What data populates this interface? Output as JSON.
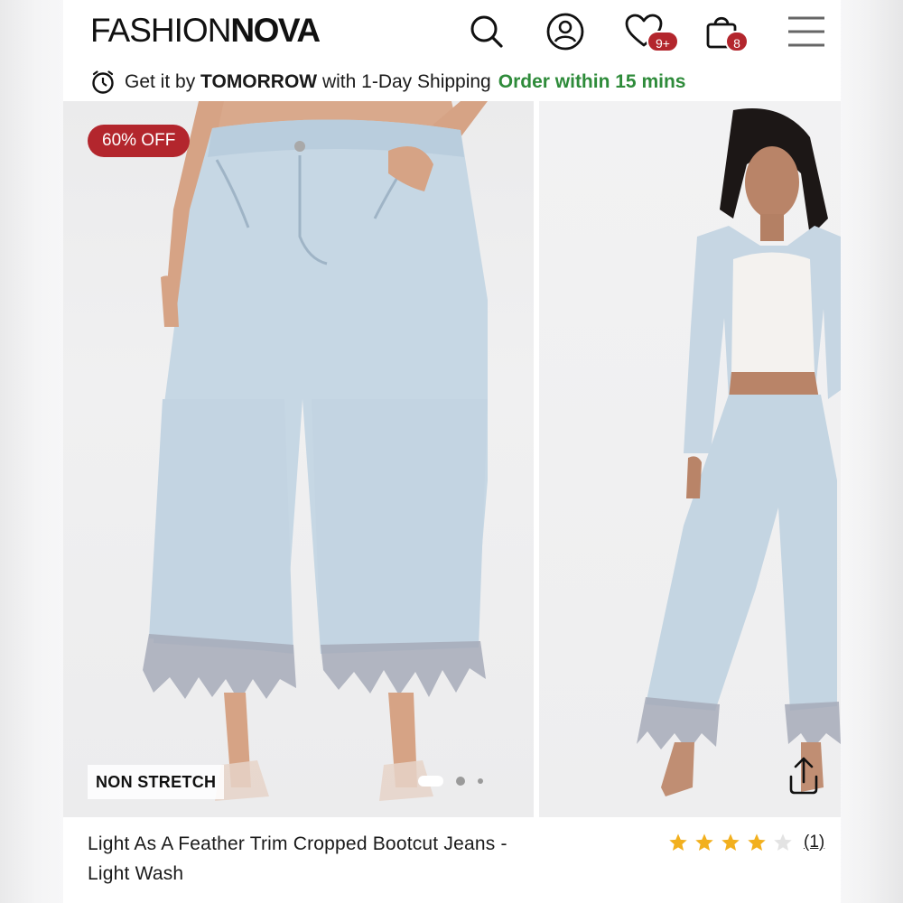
{
  "header": {
    "logo_part1": "FASHION",
    "logo_part2": "NOVA",
    "wishlist_badge": "9+",
    "cart_badge": "8",
    "icons": [
      "search-icon",
      "account-icon",
      "wishlist-heart-icon",
      "cart-bag-icon",
      "menu-hamburger-icon"
    ]
  },
  "shipping": {
    "prefix": "Get it by ",
    "highlight": "TOMORROW",
    "suffix": " with 1-Day Shipping",
    "countdown": "Order within 15 mins"
  },
  "gallery": {
    "discount": "60% OFF",
    "fabric_tag": "NON STRETCH",
    "current_slide": 1,
    "slide_count": 3
  },
  "product": {
    "title_line1": "Light As A Feather Trim Cropped Bootcut Jeans -",
    "title_line2": "Light Wash",
    "rating": 4,
    "rating_max": 5,
    "review_count": "(1)"
  },
  "colors": {
    "brand_red": "#b3262d",
    "green": "#2e8b3a",
    "denim": "#c4d5e2"
  }
}
